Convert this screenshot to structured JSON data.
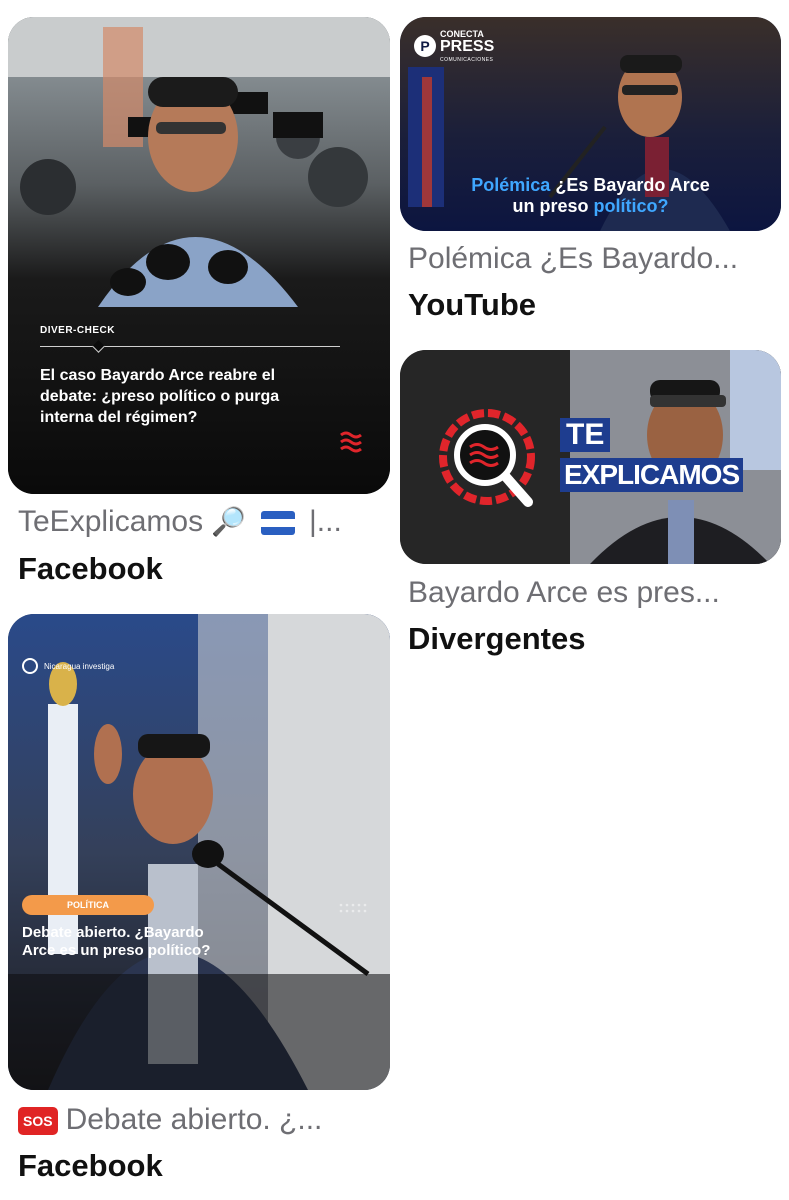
{
  "results": [
    {
      "card_overlay": {
        "tag": "DIVER-CHECK",
        "headline": "El caso Bayardo Arce reabre el debate: ¿preso político o purga interna del régimen?"
      },
      "caption": "TeExplicamos",
      "caption_suffix": "|...",
      "source": "Facebook"
    },
    {
      "card_overlay": {
        "logo_top": "CONECTA",
        "logo_main": "PRESS",
        "logo_sub": "COMUNICACIONES",
        "headline_accent": "Polémica",
        "headline_line1_rest": "¿Es Bayardo Arce",
        "headline_line2": "un preso",
        "headline_line2_accent": "político?"
      },
      "caption": "Polémica ¿Es Bayardo...",
      "source": "YouTube"
    },
    {
      "card_overlay": {
        "badge_line1": "TE",
        "badge_line2": "EXPLICAMOS"
      },
      "caption": "Bayardo Arce es pres...",
      "source": "Divergentes"
    },
    {
      "card_overlay": {
        "brand": "Nicaragua investiga",
        "pill": "POLÍTICA",
        "headline": "Debate abierto. ¿Bayardo Arce es un preso político?"
      },
      "caption_badge": "SOS",
      "caption": "Debate abierto. ¿...",
      "source": "Facebook"
    }
  ],
  "colors": {
    "caption_gray": "#6e6e73",
    "source_black": "#111111",
    "accent_blue": "#3fa7ff",
    "accent_red": "#e0252b",
    "pill_orange": "#f39a4a"
  },
  "icons": [
    "magnifier-emoji-icon",
    "nicaragua-flag-icon",
    "sos-emoji-icon",
    "dots-grid-icon"
  ]
}
